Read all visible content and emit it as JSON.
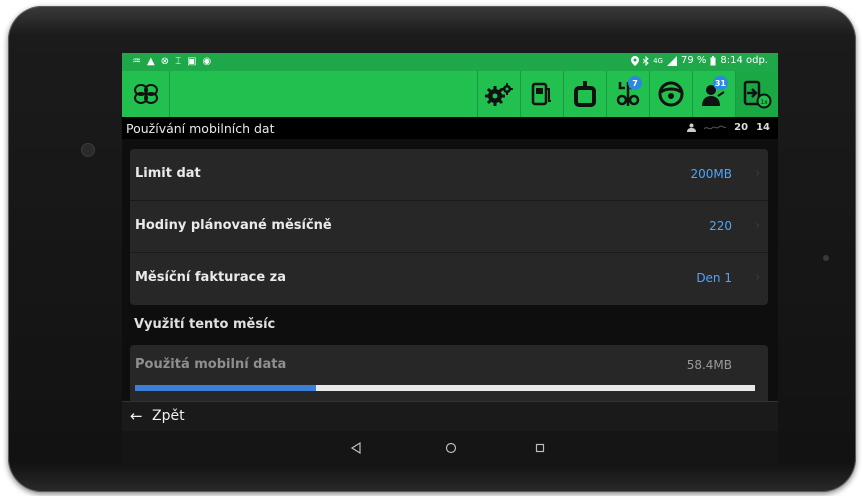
{
  "status_bar": {
    "left_icons": [
      "♒",
      "▲",
      "⊗",
      "⌶",
      "▣",
      "◉"
    ],
    "lte": "4G",
    "battery": "79 %",
    "time": "8:14 odp."
  },
  "toolbar": {
    "badges": {
      "split": "7",
      "driver": "31"
    }
  },
  "header": {
    "title": "Používání mobilních dat",
    "right_a": "20",
    "right_b": "14"
  },
  "settings": [
    {
      "label": "Limit dat",
      "value": "200MB"
    },
    {
      "label": "Hodiny plánované měsíčně",
      "value": "220"
    },
    {
      "label": "Měsíční fakturace za",
      "value": "Den 1"
    }
  ],
  "usage_section": {
    "title": "Využití tento měsíc",
    "label": "Použitá mobilní data",
    "value": "58.4MB",
    "progress_fraction": 0.292
  },
  "back": {
    "label": "Zpět"
  },
  "colors": {
    "accent_green": "#21c04f",
    "value_blue": "#4aa6ff",
    "progress_blue": "#3c7fd8"
  }
}
